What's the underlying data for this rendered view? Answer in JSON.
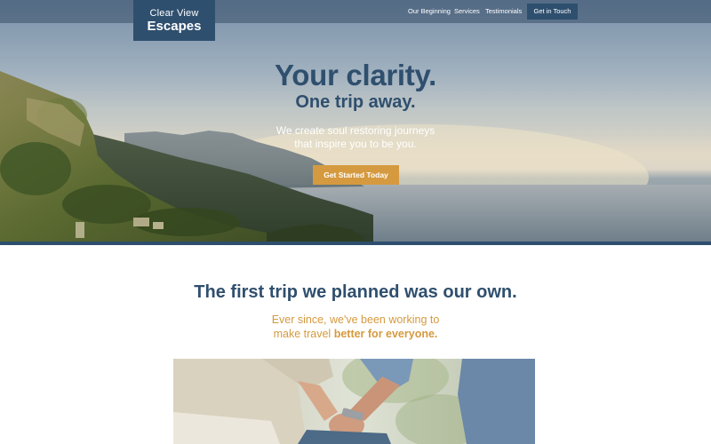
{
  "brand": {
    "line1": "Clear View",
    "line2": "Escapes"
  },
  "nav": {
    "items": [
      "Our Beginning",
      "Services",
      "Testimonials"
    ],
    "cta": "Get in Touch"
  },
  "hero": {
    "headline": "Your clarity.",
    "subheadline": "One trip away.",
    "tagline_line1": "We create soul restoring journeys",
    "tagline_line2": "that inspire you to be you.",
    "cta": "Get Started Today"
  },
  "about": {
    "title_plain": "The first trip we planned ",
    "title_bold": "was our own.",
    "sub_line1": "Ever since, we've been working to",
    "sub_line2_plain": "make travel ",
    "sub_line2_bold": "better for everyone."
  },
  "colors": {
    "navy": "#2f4f6e",
    "accent_gold": "#d59a3f"
  },
  "icons": {
    "hero_image": "coastal-mountains-sunset-photo",
    "about_image": "couple-holding-hands-photo"
  }
}
